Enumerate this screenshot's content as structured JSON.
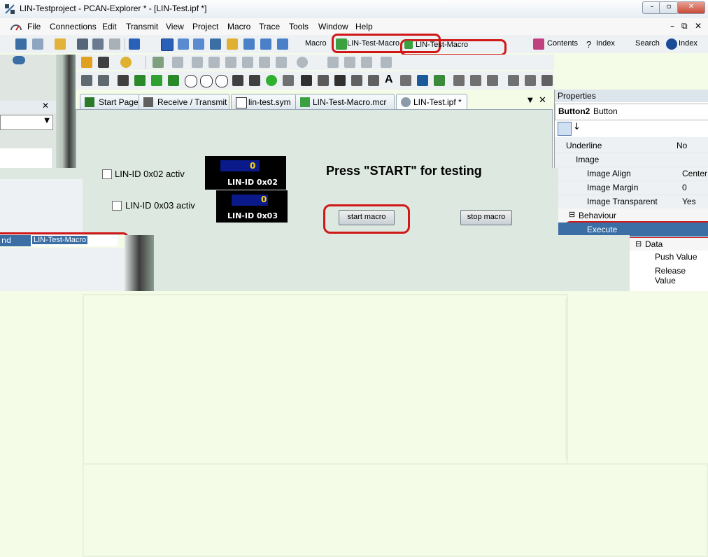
{
  "window": {
    "title": "LIN-Testproject - PCAN-Explorer * - [LIN-Test.ipf *]",
    "minimize": "–",
    "restore": "▫",
    "close": "✕"
  },
  "menu": {
    "items": [
      "File",
      "Connections",
      "Edit",
      "Transmit",
      "View",
      "Project",
      "Macro",
      "Trace",
      "Tools",
      "Window",
      "Help"
    ],
    "mdi_min": "–",
    "mdi_restore": "⧉",
    "mdi_close": "✕"
  },
  "toolbar1": {
    "macro_label": "Macro",
    "macro_combo": "LIN-Test-Macro",
    "macro_combo2": "LIN-Test-Macro",
    "contents": "Contents",
    "index": "Index",
    "search": "Search",
    "index2": "Index"
  },
  "tabs": [
    {
      "label": "Start Page",
      "icon": "start-page-icon"
    },
    {
      "label": "Receive / Transmit",
      "icon": "receive-transmit-icon"
    },
    {
      "label": "lin-test.sym",
      "icon": "symbol-file-icon"
    },
    {
      "label": "LIN-Test-Macro.mcr",
      "icon": "macro-file-icon"
    },
    {
      "label": "LIN-Test.ipf *",
      "icon": "panel-file-icon"
    }
  ],
  "tab_controls": {
    "dropdown": "▼",
    "close": "✕"
  },
  "properties": {
    "header": "Properties",
    "object": "Button2",
    "object_type": "Button",
    "rows": [
      {
        "key": "Underline",
        "value": "No"
      },
      {
        "key": "Image",
        "value": ""
      },
      {
        "key": "Image Align",
        "value": "Center"
      },
      {
        "key": "Image Margin",
        "value": "0"
      },
      {
        "key": "Image Transparent",
        "value": "Yes"
      },
      {
        "key": "Behaviour",
        "value": ""
      },
      {
        "key": "Execute",
        "value": ""
      },
      {
        "key": "Data",
        "value": ""
      },
      {
        "key": "Push Value",
        "value": ""
      },
      {
        "key": "Release Value",
        "value": ""
      }
    ]
  },
  "left_panel": {
    "selected_key": "nd",
    "selected_value": "LIN-Test-Macro",
    "close": "✕"
  },
  "surface": {
    "checkbox1": "LIN-ID 0x02 activ",
    "checkbox2": "LIN-ID 0x03 activ",
    "led1_value": "0",
    "led1_label": "LIN-ID 0x02",
    "led2_value": "0",
    "led2_label": "LIN-ID 0x03",
    "heading": "Press \"START\" for testing",
    "start_button": "start macro",
    "stop_button": "stop macro"
  },
  "colors": {
    "accent_red": "#d01818",
    "led_bg": "#000000",
    "led_bar": "#0a1a8a",
    "led_digit": "#ffd800",
    "surface": "#dce8e0",
    "selection": "#3a6ea5"
  }
}
